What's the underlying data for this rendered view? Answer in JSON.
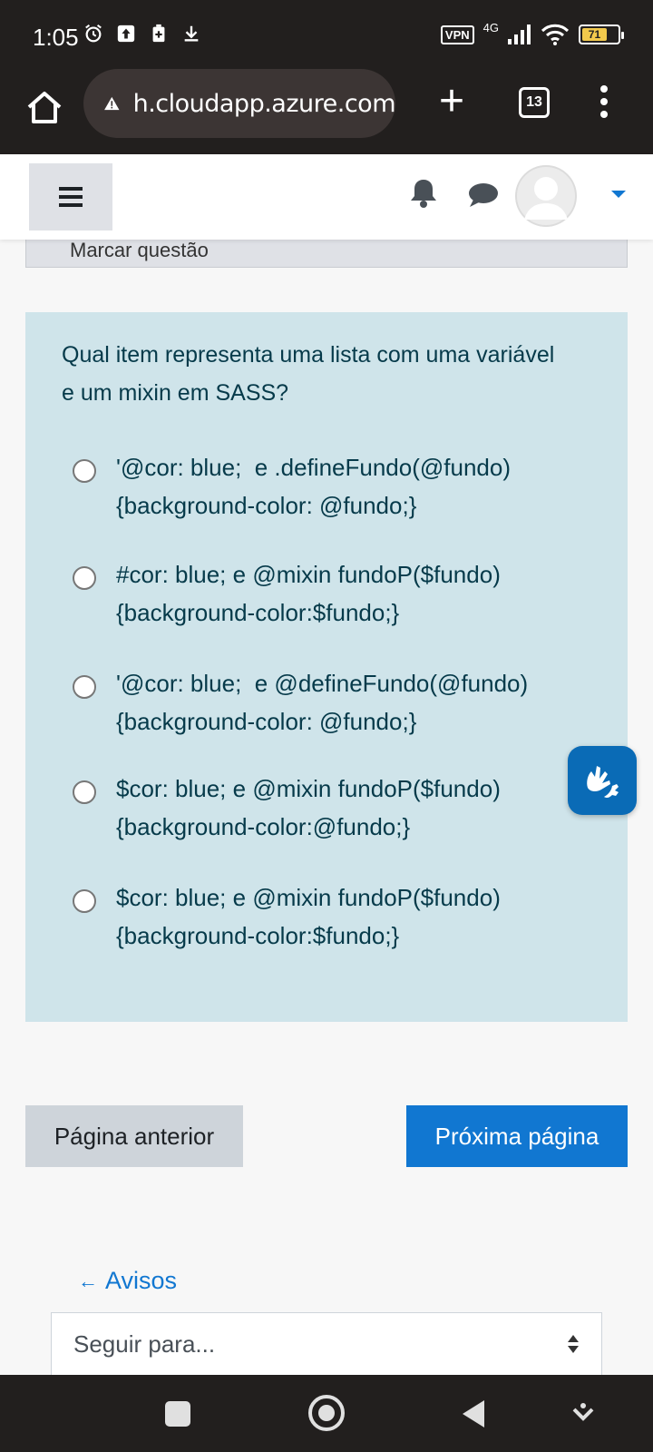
{
  "status_bar": {
    "time": "1:05",
    "vpn": "VPN",
    "network": "4G",
    "battery": "71",
    "battery_level": 0.71
  },
  "browser": {
    "url": "h.cloudapp.azure.com",
    "tab_count": "13"
  },
  "flag": {
    "label": "Marcar questão"
  },
  "question": {
    "text": "Qual item representa uma lista com uma variável e um mixin em SASS?",
    "options": [
      "'@cor: blue;  e .defineFundo(@fundo)\n{background-color: @fundo;}",
      "#cor: blue; e @mixin fundoP($fundo)\n{background-color:$fundo;}",
      "'@cor: blue;  e @defineFundo(@fundo)\n{background-color: @fundo;}",
      "$cor: blue; e @mixin fundoP($fundo)\n{background-color:@fundo;}",
      "$cor: blue; e @mixin fundoP($fundo)\n{background-color:$fundo;}"
    ]
  },
  "navigation": {
    "prev_label": "Página anterior",
    "next_label": "Próxima página"
  },
  "footer": {
    "avisos_arrow": "←",
    "avisos_label": "Avisos",
    "select_placeholder": "Seguir para..."
  },
  "colors": {
    "accent": "#1177d1",
    "question_bg": "#cfe4ea",
    "question_text": "#063a4a"
  }
}
